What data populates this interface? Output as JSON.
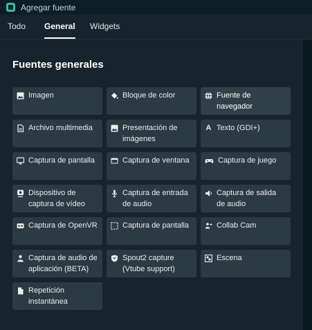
{
  "window": {
    "title": "Agregar fuente"
  },
  "tabs": [
    {
      "label": "Todo"
    },
    {
      "label": "General"
    },
    {
      "label": "Widgets"
    }
  ],
  "section": {
    "title": "Fuentes generales"
  },
  "sources": [
    {
      "label": "Imagen",
      "icon": "image-icon"
    },
    {
      "label": "Bloque de color",
      "icon": "paint-bucket-icon"
    },
    {
      "label": "Fuente de navegador",
      "icon": "globe-icon"
    },
    {
      "label": "Archivo multimedia",
      "icon": "file-icon"
    },
    {
      "label": "Presentación de imágenes",
      "icon": "slideshow-icon"
    },
    {
      "label": "Texto (GDI+)",
      "icon": "text-icon"
    },
    {
      "label": "Captura de pantalla",
      "icon": "monitor-icon"
    },
    {
      "label": "Captura de ventana",
      "icon": "window-icon"
    },
    {
      "label": "Captura de juego",
      "icon": "gamepad-icon"
    },
    {
      "label": "Dispositivo de captura de vídeo",
      "icon": "webcam-icon"
    },
    {
      "label": "Captura de entrada de audio",
      "icon": "microphone-icon"
    },
    {
      "label": "Captura de salida de audio",
      "icon": "speaker-icon"
    },
    {
      "label": "Captura de OpenVR",
      "icon": "vr-headset-icon"
    },
    {
      "label": "Captura de pantalla",
      "icon": "selection-icon"
    },
    {
      "label": "Collab Cam",
      "icon": "users-icon"
    },
    {
      "label": "Captura de audio de aplicación (BETA)",
      "icon": "user-icon"
    },
    {
      "label": "Spout2 capture (Vtube support)",
      "icon": "shield-icon"
    },
    {
      "label": "Escena",
      "icon": "scene-icon"
    },
    {
      "label": "Repetición instantánea",
      "icon": "replay-file-icon"
    }
  ]
}
